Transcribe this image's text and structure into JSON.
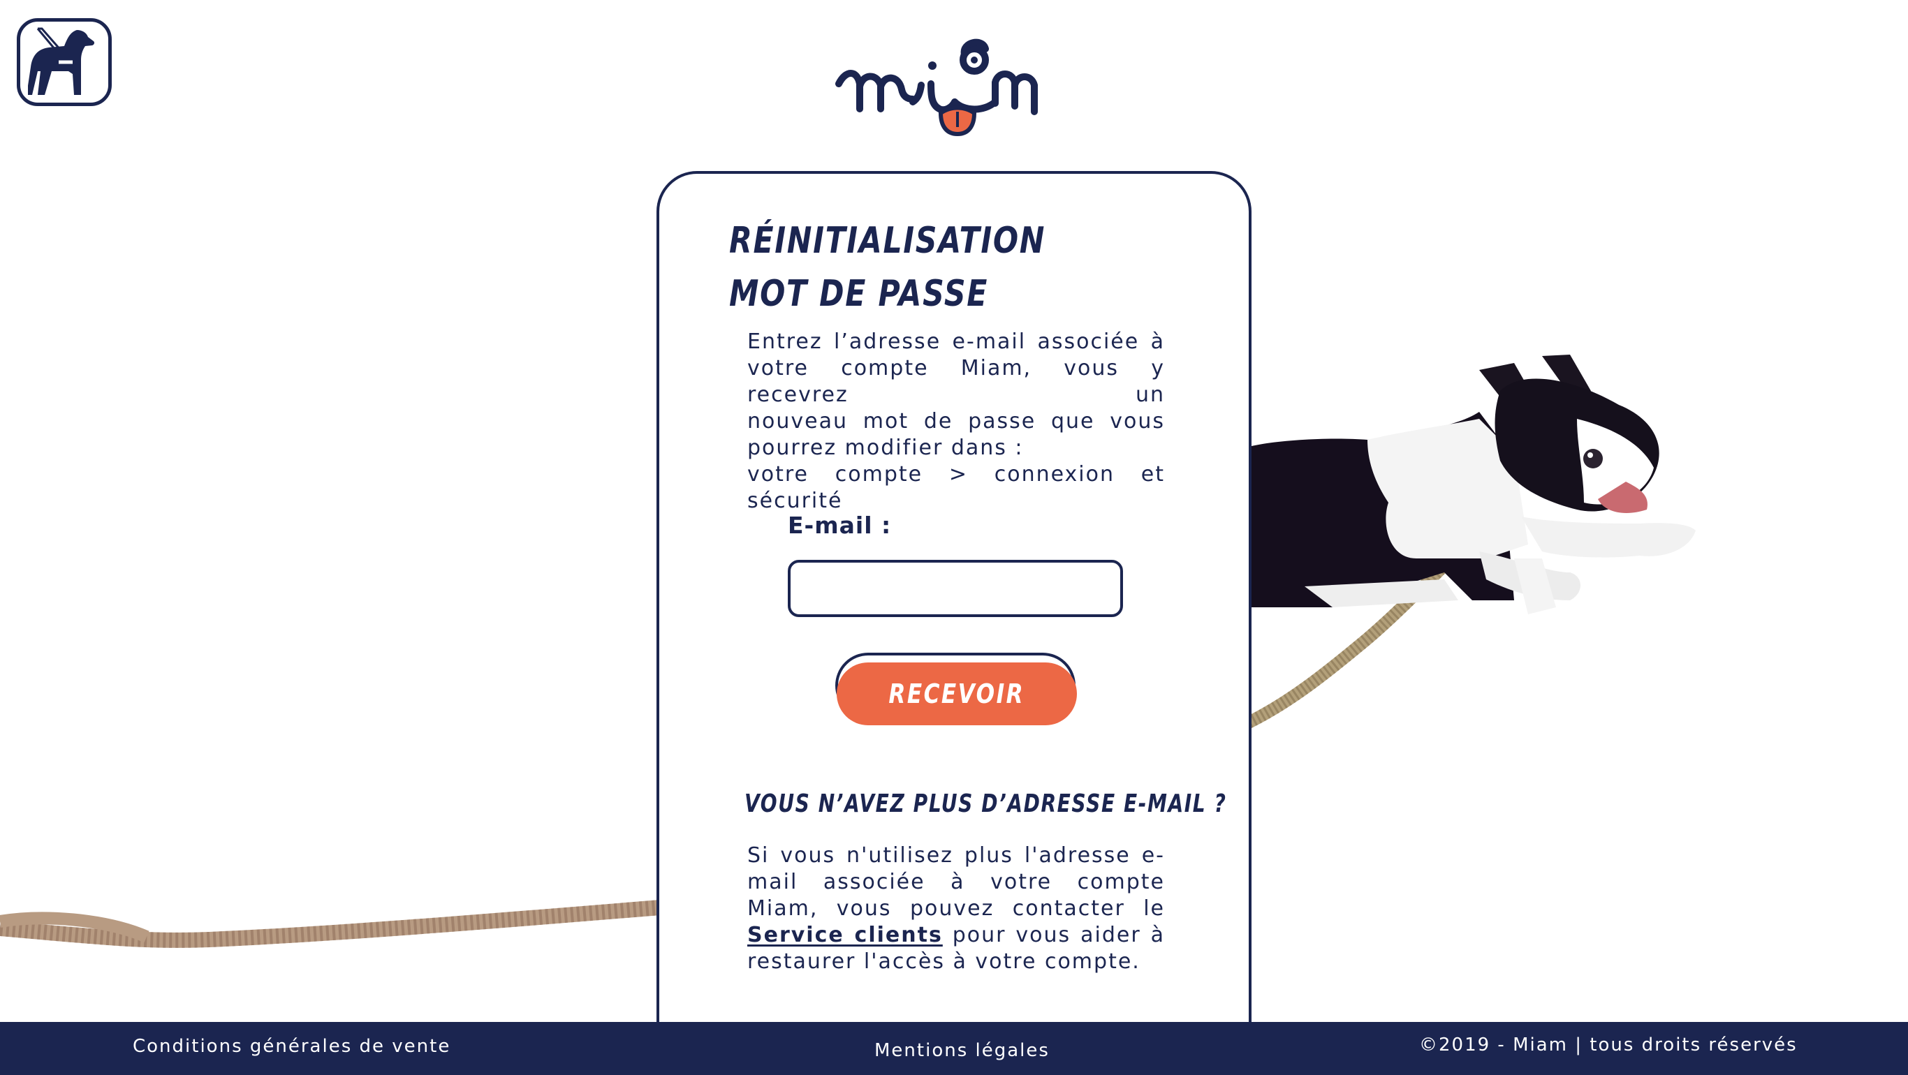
{
  "accessibility": {
    "icon": "guide-dog-icon"
  },
  "logo": {
    "text": "Miam"
  },
  "card": {
    "title_line1": "Réinitialisation",
    "title_line2": "mot de passe",
    "intro_lines": [
      "Entrez l’adresse e-mail associée à",
      "votre compte Miam, vous y recevrez un",
      "nouveau mot de passe que vous",
      "pourrez modifier dans :",
      "votre compte > connexion et sécurité"
    ],
    "email_label": "E-mail :",
    "email_value": "",
    "button_label": "Recevoir",
    "subtitle": "Vous n’avez plus d’adresse e-mail ?",
    "para_before": "Si vous n'utilisez plus l'adresse e-mail associée à votre compte Miam, vous pouvez contacter le ",
    "para_link": "Service clients",
    "para_after": " pour vous aider à restaurer l'accès à votre compte."
  },
  "footer": {
    "cgv": "Conditions générales de vente",
    "legal": "Mentions légales",
    "copyright": "©2019 - Miam | tous droits réservés"
  },
  "colors": {
    "navy": "#1b2550",
    "orange": "#ec6845"
  }
}
